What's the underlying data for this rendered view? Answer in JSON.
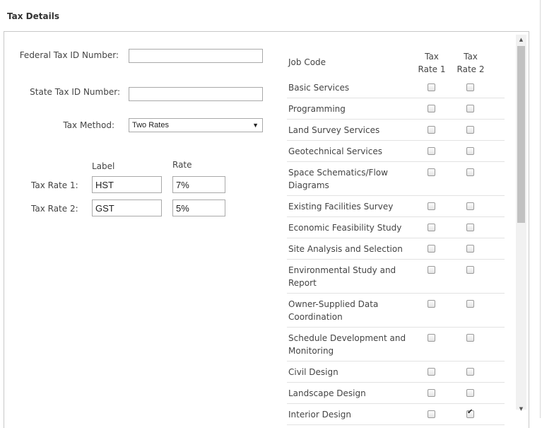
{
  "header": {
    "title": "Tax Details"
  },
  "form": {
    "federal_label": "Federal Tax ID Number:",
    "federal_value": "",
    "state_label": "State Tax ID Number:",
    "state_value": "",
    "method_label": "Tax Method:",
    "method_value": "Two Rates",
    "col_label": "Label",
    "col_rate": "Rate",
    "rate1_label": "Tax Rate 1:",
    "rate1_name": "HST",
    "rate1_value": "7%",
    "rate2_label": "Tax Rate 2:",
    "rate2_name": "GST",
    "rate2_value": "5%"
  },
  "table": {
    "col_job": "Job Code",
    "col_rate1_line1": "Tax",
    "col_rate1_line2": "Rate 1",
    "col_rate2_line1": "Tax",
    "col_rate2_line2": "Rate 2",
    "rows": [
      {
        "name": "Basic Services",
        "r1": false,
        "r2": false
      },
      {
        "name": "Programming",
        "r1": false,
        "r2": false
      },
      {
        "name": "Land Survey Services",
        "r1": false,
        "r2": false
      },
      {
        "name": "Geotechnical Services",
        "r1": false,
        "r2": false
      },
      {
        "name": "Space Schematics/Flow Diagrams",
        "r1": false,
        "r2": false
      },
      {
        "name": "Existing Facilities Survey",
        "r1": false,
        "r2": false
      },
      {
        "name": "Economic Feasibility Study",
        "r1": false,
        "r2": false
      },
      {
        "name": "Site Analysis and Selection",
        "r1": false,
        "r2": false
      },
      {
        "name": "Environmental Study and Report",
        "r1": false,
        "r2": false
      },
      {
        "name": "Owner-Supplied Data Coordination",
        "r1": false,
        "r2": false
      },
      {
        "name": "Schedule Development and Monitoring",
        "r1": false,
        "r2": false
      },
      {
        "name": "Civil Design",
        "r1": false,
        "r2": false
      },
      {
        "name": "Landscape Design",
        "r1": false,
        "r2": false
      },
      {
        "name": "Interior Design",
        "r1": false,
        "r2": true
      }
    ]
  },
  "scrollbar": {
    "up_icon": "▲",
    "down_icon": "▼"
  },
  "select_arrow_icon": "▼",
  "check_icon": "✔"
}
